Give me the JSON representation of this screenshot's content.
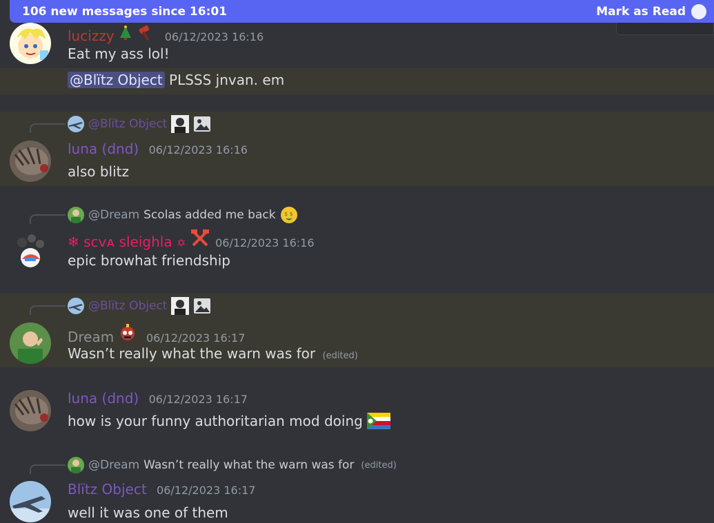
{
  "banner": {
    "text": "106 new messages since 16:01",
    "action": "Mark as Read"
  },
  "messages": [
    {
      "author": "lucizzy",
      "time": "06/12/2023 16:16",
      "lines": [
        "Eat my ass lol!"
      ],
      "mention_line": {
        "mention": "@Blïtz Object",
        "text": "PLSSS jnvan. em"
      }
    },
    {
      "reply": {
        "author": "@Blïtz Object"
      },
      "author": "luna (dnd)",
      "time": "06/12/2023 16:16",
      "body": "also blitz"
    },
    {
      "reply": {
        "author": "@Dream",
        "text": "Scolas added me back"
      },
      "author": "ꜱᴄᴠᴀ sleighla",
      "time": "06/12/2023 16:16",
      "body": "epic browhat friendship"
    },
    {
      "reply": {
        "author": "@Blïtz Object"
      },
      "author": "Dream",
      "time": "06/12/2023 16:17",
      "body": "Wasn’t really what the warn was for",
      "edited": "(edited)"
    },
    {
      "author": "luna (dnd)",
      "time": "06/12/2023 16:17",
      "body": "how is your funny authoritarian mod doing"
    },
    {
      "reply": {
        "author": "@Dream",
        "text": "Wasn’t really what the warn was for",
        "edited": "(edited)"
      },
      "author": "Blïtz Object",
      "time": "06/12/2023 16:17",
      "body": "well it was one of them"
    }
  ],
  "colors": {
    "background": "#313338",
    "banner": "#5865f2",
    "highlight": "#3a3a33",
    "lucizzy": "#c0392b",
    "purple_name": "#7e57c2",
    "pink_name": "#e91e63",
    "dream": "#8e9297",
    "meta": "#949ba4"
  },
  "icons": [
    "christmas-tree-icon",
    "hammer-icon",
    "jet-avatar-icon",
    "portrait-icon",
    "image-icon",
    "money-face-emoji-icon",
    "snowflake-icon",
    "hammer-pick-icon",
    "flag-emoji-icon",
    "robot-emoji-icon"
  ]
}
